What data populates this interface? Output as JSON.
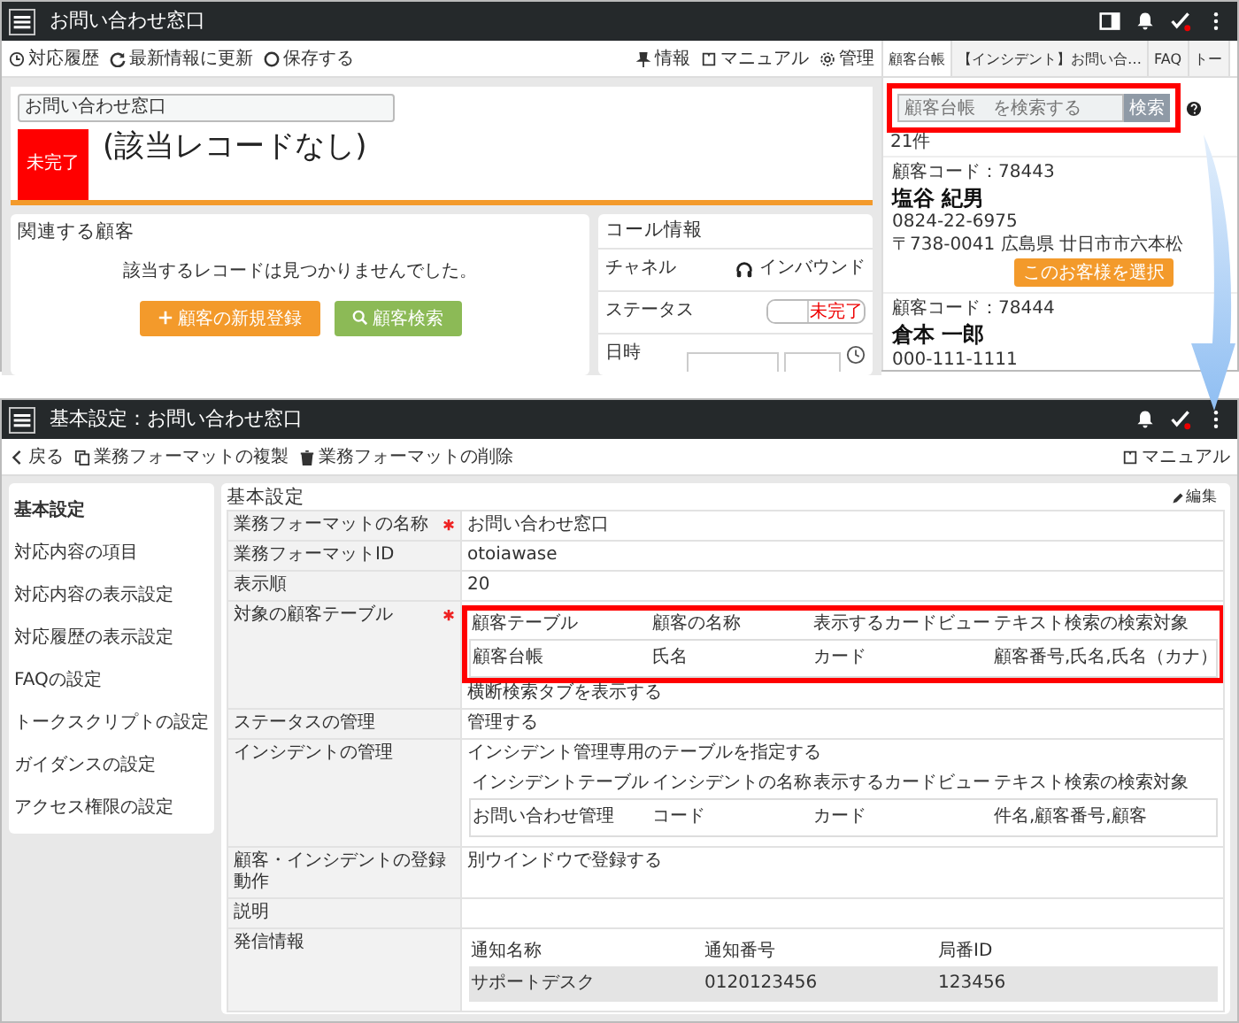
{
  "top_screen": {
    "header": {
      "title": "お問い合わせ窓口"
    },
    "toolbar": {
      "left": [
        {
          "kind": "history",
          "label": "対応履歴"
        },
        {
          "kind": "refresh",
          "label": "最新情報に更新"
        },
        {
          "kind": "save",
          "label": "保存する"
        }
      ],
      "right": [
        {
          "kind": "info",
          "label": "情報"
        },
        {
          "kind": "manual",
          "label": "マニュアル"
        },
        {
          "kind": "admin",
          "label": "管理"
        }
      ]
    },
    "record": {
      "name_field": "お問い合わせ窓口",
      "status": "未完了",
      "title": "(該当レコードなし)"
    },
    "related_customers": {
      "title": "関連する顧客",
      "message": "該当するレコードは見つかりませんでした。",
      "buttons": [
        {
          "kind": "add",
          "label": "顧客の新規登録"
        },
        {
          "kind": "search",
          "label": "顧客検索"
        }
      ]
    },
    "call_info": {
      "title": "コール情報",
      "rows": [
        {
          "kind": "channel",
          "label": "チャネル",
          "value": "インバウンド"
        },
        {
          "kind": "toggle",
          "label": "ステータス",
          "value": "未完了"
        },
        {
          "kind": "datetime",
          "label": "日時"
        }
      ]
    },
    "side_panel": {
      "tabs": [
        {
          "label": "顧客台帳",
          "selected": true
        },
        {
          "label": "【インシデント】お問い合…",
          "selected": false
        },
        {
          "label": "FAQ",
          "selected": false
        },
        {
          "label": "トー",
          "selected": false
        }
      ],
      "search": {
        "placeholder": "顧客台帳　を検索する",
        "button": "検索",
        "highlighted": true
      },
      "count": "21件",
      "customers": [
        {
          "code": "顧客コード：78443",
          "name": "塩谷 紀男",
          "phone": "0824-22-6975",
          "address": "〒738-0041 広島県 廿日市市六本松",
          "select_button": "このお客様を選択"
        },
        {
          "code": "顧客コード：78444",
          "name": "倉本 一郎",
          "phone": "000-111-1111"
        }
      ]
    }
  },
  "bottom_screen": {
    "header": {
      "title": "基本設定：お問い合わせ窓口"
    },
    "toolbar": {
      "left": [
        {
          "kind": "back",
          "label": "戻る"
        },
        {
          "kind": "copy",
          "label": "業務フォーマットの複製"
        },
        {
          "kind": "delete",
          "label": "業務フォーマットの削除"
        }
      ],
      "right": [
        {
          "kind": "manual",
          "label": "マニュアル"
        }
      ]
    },
    "sidebar": {
      "items": [
        {
          "label": "基本設定",
          "selected": true
        },
        {
          "label": "対応内容の項目",
          "selected": false
        },
        {
          "label": "対応内容の表示設定",
          "selected": false
        },
        {
          "label": "対応履歴の表示設定",
          "selected": false
        },
        {
          "label": "FAQの設定",
          "selected": false
        },
        {
          "label": "トークスクリプトの設定",
          "selected": false
        },
        {
          "label": "ガイダンスの設定",
          "selected": false
        },
        {
          "label": "アクセス権限の設定",
          "selected": false
        }
      ]
    },
    "settings": {
      "title": "基本設定",
      "edit_link": "編集",
      "rows": [
        {
          "label": "業務フォーマットの名称",
          "required": true,
          "value": "お問い合わせ窓口"
        },
        {
          "label": "業務フォーマットID",
          "required": false,
          "value": "otoiawase"
        },
        {
          "label": "表示順",
          "required": false,
          "value": "20"
        },
        {
          "label": "対象の顧客テーブル",
          "required": true,
          "table": {
            "highlighted": true,
            "columns": [
              "顧客テーブル",
              "顧客の名称",
              "表示するカードビュー",
              "テキスト検索の検索対象"
            ],
            "rows": [
              [
                "顧客台帳",
                "氏名",
                "カード",
                "顧客番号,氏名,氏名（カナ）"
              ]
            ]
          },
          "note": "横断検索タブを表示する"
        },
        {
          "label": "ステータスの管理",
          "required": false,
          "value": "管理する"
        },
        {
          "label": "インシデントの管理",
          "required": false,
          "value": "インシデント管理専用のテーブルを指定する",
          "table": {
            "highlighted": false,
            "columns": [
              "インシデントテーブル",
              "インシデントの名称",
              "表示するカードビュー",
              "テキスト検索の検索対象"
            ],
            "rows": [
              [
                "お問い合わせ管理",
                "コード",
                "カード",
                "件名,顧客番号,顧客"
              ]
            ]
          }
        },
        {
          "label": "顧客・インシデントの登録動作",
          "required": false,
          "value": "別ウインドウで登録する"
        },
        {
          "label": "説明",
          "required": false
        },
        {
          "label": "発信情報",
          "required": false,
          "table": {
            "kind": "shaded",
            "highlighted": false,
            "columns": [
              "通知名称",
              "通知番号",
              "局番ID"
            ],
            "rows": [
              [
                "サポートデスク",
                "0120123456",
                "123456"
              ]
            ]
          }
        }
      ]
    }
  }
}
